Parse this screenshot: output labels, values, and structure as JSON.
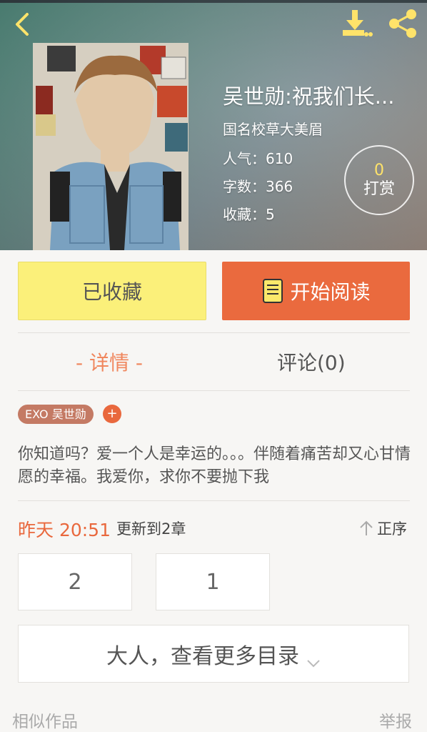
{
  "header": {
    "title": "吴世勋:祝我们长...",
    "author": "国名校草大美眉",
    "stats": {
      "popularity": "人气：610",
      "words": "字数：366",
      "favorites": "收藏：5"
    },
    "tip": {
      "count": "0",
      "label": "打赏"
    },
    "icons": [
      "back-icon",
      "download-icon",
      "share-icon"
    ]
  },
  "actions": {
    "collected_label": "已收藏",
    "read_label": "开始阅读"
  },
  "tabs": {
    "detail": "- 详情 -",
    "comments": "评论(0)"
  },
  "tags": {
    "items": [
      "EXO 吴世勋"
    ],
    "add": "+"
  },
  "description": "你知道吗？爱一个人是幸运的。。。伴随着痛苦却又心甘情愿的幸福。我爱你，求你不要抛下我",
  "update": {
    "time": "昨天 20:51",
    "text": "更新到2章",
    "sort_label": "正序"
  },
  "chapters": [
    "2",
    "1"
  ],
  "more_catalog": "大人，查看更多目录",
  "footer": {
    "similar": "相似作品",
    "report": "举报"
  },
  "colors": {
    "accent": "#ea6a3e",
    "collected_bg": "#fbf07a",
    "tip_count": "#ffe36a"
  }
}
